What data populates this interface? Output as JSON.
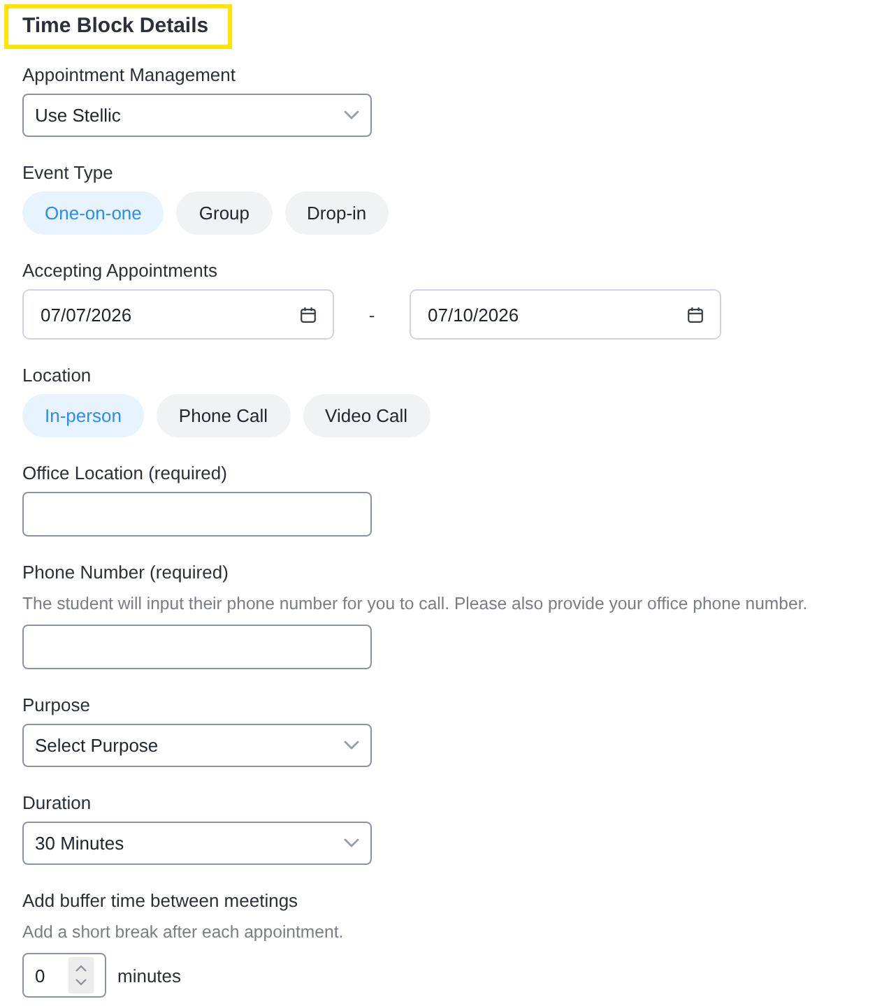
{
  "title": "Time Block Details",
  "fields": [
    {
      "kind": "select",
      "label": "Appointment Management",
      "value": "Use Stellic"
    },
    {
      "kind": "choices",
      "label": "Event Type",
      "options": [
        {
          "label": "One-on-one",
          "selected": true
        },
        {
          "label": "Group",
          "selected": false
        },
        {
          "label": "Drop-in",
          "selected": false
        }
      ]
    },
    {
      "kind": "date_range",
      "label": "Accepting Appointments",
      "start": "07/07/2026",
      "separator": "-",
      "end": "07/10/2026"
    },
    {
      "kind": "choices",
      "label": "Location",
      "options": [
        {
          "label": "In-person",
          "selected": true
        },
        {
          "label": "Phone Call",
          "selected": false
        },
        {
          "label": "Video Call",
          "selected": false
        }
      ]
    },
    {
      "kind": "text",
      "label": "Office Location (required)"
    },
    {
      "kind": "text",
      "label": "Phone Number (required)",
      "help": "The student will input their phone number for you to call. Please also provide your office phone number."
    },
    {
      "kind": "select",
      "label": "Purpose",
      "value": "Select Purpose"
    },
    {
      "kind": "select",
      "label": "Duration",
      "value": "30 Minutes"
    },
    {
      "kind": "number",
      "label": "Add buffer time between meetings",
      "help": "Add a short break after each appointment.",
      "value": "0",
      "unit": "minutes"
    }
  ]
}
